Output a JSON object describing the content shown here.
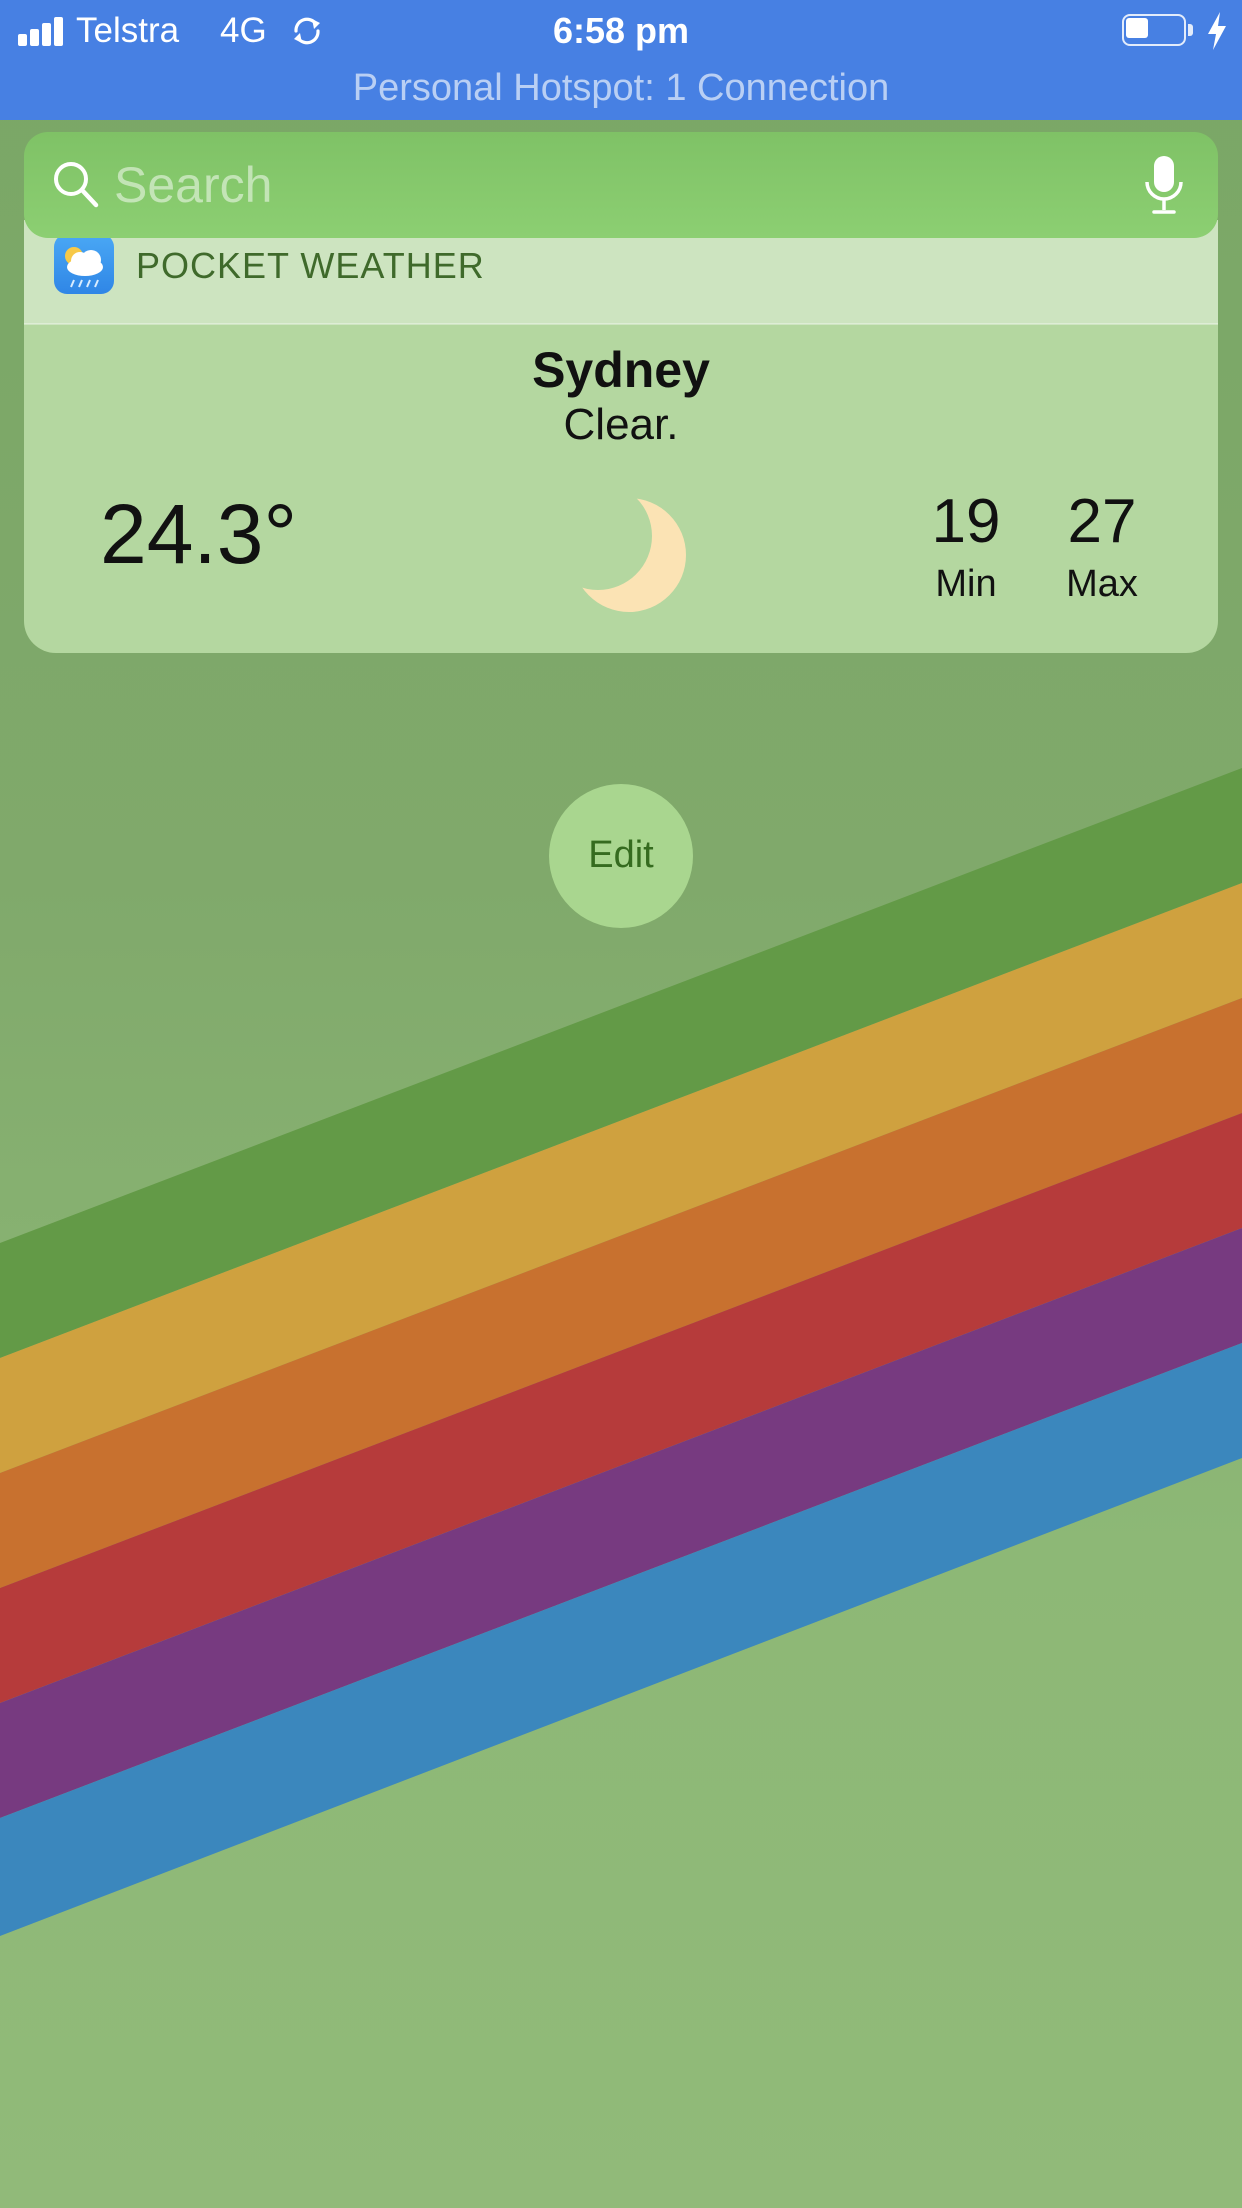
{
  "status_bar": {
    "carrier": "Telstra",
    "network": "4G",
    "time": "6:58 pm",
    "hotspot_text": "Personal Hotspot: 1 Connection",
    "icons": [
      "signal-bars-icon",
      "sync-icon",
      "battery-icon",
      "charging-bolt-icon"
    ],
    "background_color": "#4780e3"
  },
  "search": {
    "placeholder": "Search",
    "icons": [
      "search-icon",
      "microphone-icon"
    ]
  },
  "widget": {
    "app_name": "POCKET WEATHER",
    "app_icon": "weather-app-icon",
    "city": "Sydney",
    "condition": "Clear.",
    "temperature": "24.3°",
    "condition_icon": "crescent-moon-icon",
    "min": {
      "value": "19",
      "label": "Min"
    },
    "max": {
      "value": "27",
      "label": "Max"
    }
  },
  "edit_button": {
    "label": "Edit"
  },
  "wallpaper": {
    "stripe_colors": [
      "#639a47",
      "#cfa13f",
      "#c8712f",
      "#b63b3b",
      "#773a80",
      "#3b87bd"
    ]
  }
}
